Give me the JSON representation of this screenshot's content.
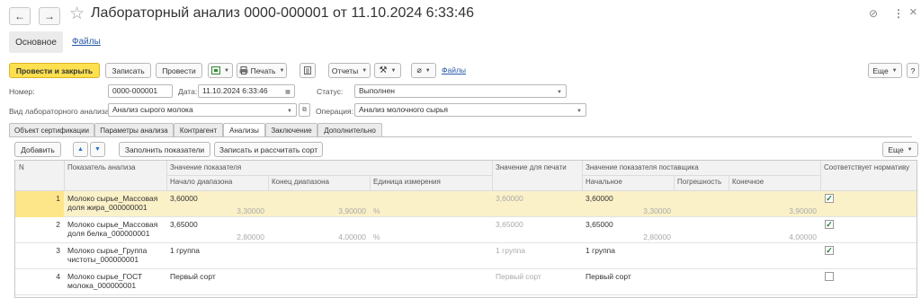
{
  "window": {
    "title": "Лабораторный анализ 0000-000001 от 11.10.2024 6:33:46",
    "back_icon": "←",
    "forward_icon": "→",
    "star_icon": "☆",
    "link_icon": "⊘",
    "more_icon": "⋮",
    "close_icon": "×"
  },
  "section_tabs": {
    "main": "Основное",
    "files": "Файлы"
  },
  "toolbar": {
    "post_and_close": "Провести и закрыть",
    "save": "Записать",
    "post": "Провести",
    "print": "Печать",
    "reports": "Отчеты",
    "files_link": "Файлы",
    "more": "Еще",
    "help": "?"
  },
  "form": {
    "number_label": "Номер:",
    "number_value": "0000-000001",
    "date_label": "Дата:",
    "date_value": "11.10.2024  6:33:46",
    "status_label": "Статус:",
    "status_value": "Выполнен",
    "analysis_type_label": "Вид лабораторного анализа:",
    "analysis_type_value": "Анализ сырого молока",
    "operation_label": "Операция:",
    "operation_value": "Анализ молочного сырья"
  },
  "content_tabs": [
    "Объект сертификации",
    "Параметры анализа",
    "Контрагент",
    "Анализы",
    "Заключение",
    "Дополнительно"
  ],
  "table_toolbar": {
    "add": "Добавить",
    "up_icon": "▲",
    "down_icon": "▼",
    "fill": "Заполнить показатели",
    "save_calc": "Записать и рассчитать сорт",
    "more": "Еще"
  },
  "table": {
    "headers": {
      "n": "N",
      "indicator": "Показатель анализа",
      "value_group": "Значение показателя",
      "range_start": "Начало диапазона",
      "range_end": "Конец диапазона",
      "unit": "Единица измерения",
      "print_value": "Значение для печати",
      "supplier_group": "Значение показателя поставщика",
      "initial": "Начальное",
      "error": "Погрешность",
      "final": "Конечное",
      "compliant": "Соответствует нормативу"
    },
    "rows": [
      {
        "n": "1",
        "indicator_l1": "Молоко сырье_Массовая",
        "indicator_l2": "доля жира_000000001",
        "value": "3,60000",
        "range_start": "3,30000",
        "range_end": "3,90000",
        "unit": "%",
        "print_value": "3,60000",
        "initial": "3,60000",
        "error": "3,30000",
        "final": "3,90000",
        "compliant": true,
        "selected": true
      },
      {
        "n": "2",
        "indicator_l1": "Молоко сырье_Массовая",
        "indicator_l2": "доля белка_000000001",
        "value": "3,65000",
        "range_start": "2,80000",
        "range_end": "4,00000",
        "unit": "%",
        "print_value": "3,65000",
        "initial": "3,65000",
        "error": "2,80000",
        "final": "4,00000",
        "compliant": true,
        "selected": false
      },
      {
        "n": "3",
        "indicator_l1": "Молоко сырье_Группа",
        "indicator_l2": "чистоты_000000001",
        "value": "1 группа",
        "range_start": "",
        "range_end": "",
        "unit": "",
        "print_value": "1 группа",
        "initial": "1 группа",
        "error": "",
        "final": "",
        "compliant": true,
        "selected": false
      },
      {
        "n": "4",
        "indicator_l1": "Молоко сырье_ГОСТ",
        "indicator_l2": "молока_000000001",
        "value": "Первый сорт",
        "range_start": "",
        "range_end": "",
        "unit": "",
        "print_value": "Первый сорт",
        "initial": "Первый сорт",
        "error": "",
        "final": "",
        "compliant": false,
        "selected": false
      }
    ]
  }
}
